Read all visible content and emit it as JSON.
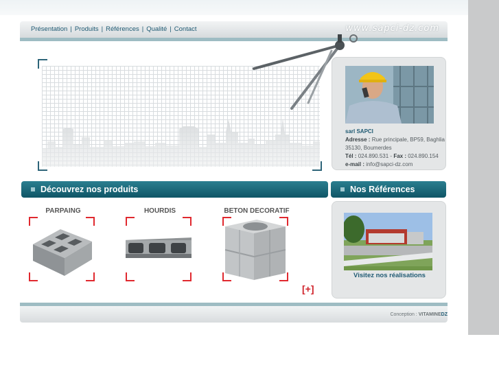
{
  "nav": {
    "links": [
      "Présentation",
      "Produits",
      "Références",
      "Qualité",
      "Contact"
    ],
    "site_url": "www.sapci-dz.com"
  },
  "contact": {
    "company": "sarl SAPCI",
    "address_label": "Adresse :",
    "address": "Rue principale, BP59, Baghlia 35130, Boumerdes",
    "tel_label": "Tél :",
    "tel": "024.890.531",
    "fax_label": "Fax :",
    "fax": "024.890.154",
    "email_label": "e-mail :",
    "email": "info@sapci-dz.com"
  },
  "sections": {
    "products_title": "Découvrez nos produits",
    "references_title": "Nos Références"
  },
  "products": [
    {
      "label": "PARPAING"
    },
    {
      "label": "HOURDIS"
    },
    {
      "label": "BETON DECORATIF"
    }
  ],
  "more_link": "[+]",
  "references": {
    "link": "Visitez nos réalisations"
  },
  "footer": {
    "credit_prefix": "Conception :",
    "credit_name": "VITAMINE",
    "credit_suffix": "DZ"
  },
  "colors": {
    "accent": "#1f5a73",
    "section_bar": "#0f5566",
    "frame_red": "#e0282e"
  }
}
